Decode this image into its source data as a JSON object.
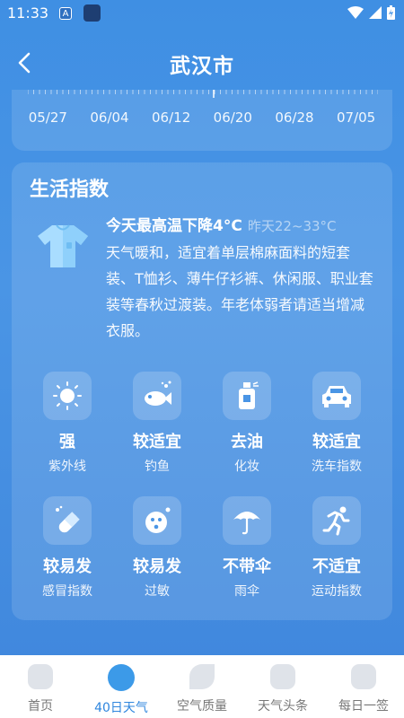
{
  "status": {
    "time": "11:33",
    "a_icon": "A"
  },
  "header": {
    "title": "武汉市"
  },
  "timeline": {
    "dates": [
      "05/27",
      "06/04",
      "06/12",
      "06/20",
      "06/28",
      "07/05"
    ]
  },
  "life": {
    "title": "生活指数",
    "headline": "今天最高温下降4°C",
    "yesterday": "昨天22~33°C",
    "description": "天气暖和，适宜着单层棉麻面料的短套装、T恤衫、薄牛仔衫裤、休闲服、职业套装等春秋过渡装。年老体弱者请适当增减衣服。",
    "items": [
      {
        "value": "强",
        "label": "紫外线",
        "icon": "sun-icon"
      },
      {
        "value": "较适宜",
        "label": "钓鱼",
        "icon": "fish-icon"
      },
      {
        "value": "去油",
        "label": "化妆",
        "icon": "cosmetic-bottle-icon"
      },
      {
        "value": "较适宜",
        "label": "洗车指数",
        "icon": "car-icon"
      },
      {
        "value": "较易发",
        "label": "感冒指数",
        "icon": "pill-icon"
      },
      {
        "value": "较易发",
        "label": "过敏",
        "icon": "allergy-icon"
      },
      {
        "value": "不带伞",
        "label": "雨伞",
        "icon": "umbrella-icon"
      },
      {
        "value": "不适宜",
        "label": "运动指数",
        "icon": "running-icon"
      }
    ]
  },
  "nav": {
    "items": [
      {
        "label": "首页",
        "icon": "home-icon"
      },
      {
        "label": "40日天气",
        "icon": "cloud-icon",
        "active": true
      },
      {
        "label": "空气质量",
        "icon": "leaf-icon"
      },
      {
        "label": "天气头条",
        "icon": "news-icon"
      },
      {
        "label": "每日一签",
        "icon": "sign-icon"
      }
    ]
  },
  "colors": {
    "accent": "#2f86de",
    "background": "#4a95e5"
  }
}
